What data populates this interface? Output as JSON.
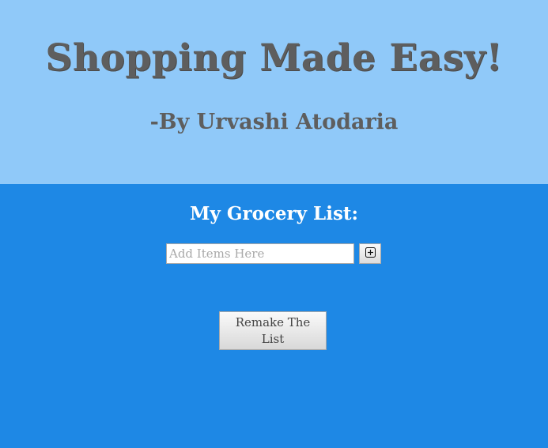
{
  "header": {
    "title": "Shopping Made Easy!",
    "byline": "-By Urvashi Atodaria"
  },
  "main": {
    "list_heading": "My Grocery List:",
    "item_input": {
      "placeholder": "Add Items Here",
      "value": ""
    },
    "add_button_icon": "plus-box-icon",
    "remake_button_label": "Remake The List"
  },
  "colors": {
    "header_bg": "#90c9f9",
    "main_bg": "#1e88e5",
    "heading_text": "#5e5e5e",
    "list_heading_text": "#ffffff"
  }
}
